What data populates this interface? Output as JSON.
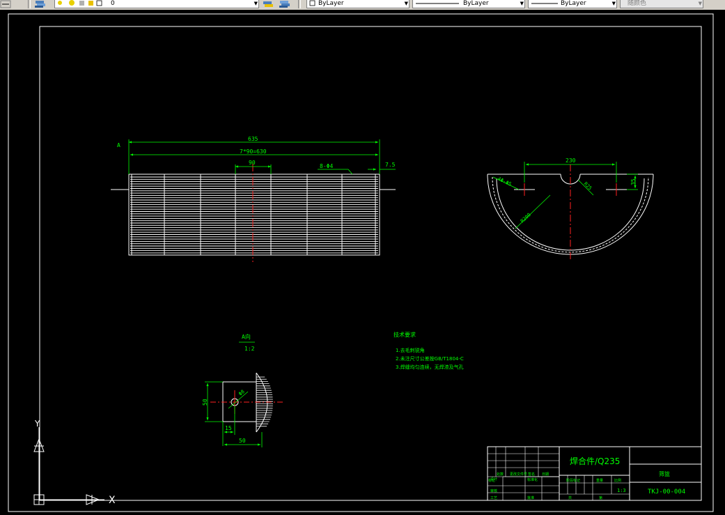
{
  "toolbar": {
    "layer_name": "0",
    "color_value": "ByLayer",
    "linetype_value": "ByLayer",
    "lineweight_value": "ByLayer",
    "plotstyle_value": "随颜色"
  },
  "drawing": {
    "main_view": {
      "label_A": "A",
      "dim_overall": "635",
      "dim_pitch_total": "7*90=630",
      "dim_pitch": "90",
      "dim_holes": "8-Φ4",
      "dim_edge": "7.5"
    },
    "side_view": {
      "dim_width": "230",
      "dim_holes": "4Φ-Φ5",
      "dim_r_small": "R25",
      "dim_height": "35",
      "dim_radius": "R200"
    },
    "detail_view": {
      "title": "A向",
      "scale": "1:2",
      "dim_height": "50",
      "dim_hole": "Φ8",
      "dim_offset": "15",
      "dim_width": "50"
    },
    "tech_notes": {
      "title": "技术要求",
      "lines": [
        "1.去毛刺锐角",
        "2.未注尺寸公差按GB/T1804-C",
        "3.焊缝均匀连续，无焊渣及气孔"
      ]
    },
    "title_block": {
      "material": "焊合件/Q235",
      "part_name": "筛篮",
      "drawing_number": "TKJ-00-004",
      "scale": "1:3",
      "row_labels": [
        "标记",
        "处数",
        "更改文件号",
        "签名",
        "日期",
        "设计",
        "标准化",
        "审核",
        "工艺",
        "批准"
      ],
      "stage_label": "阶段标记",
      "weight_label": "重量",
      "scale_label": "比例",
      "sheet_label": "共",
      "sheet_of_label": "第"
    },
    "ucs": {
      "x_label": "X",
      "y_label": "Y"
    }
  }
}
